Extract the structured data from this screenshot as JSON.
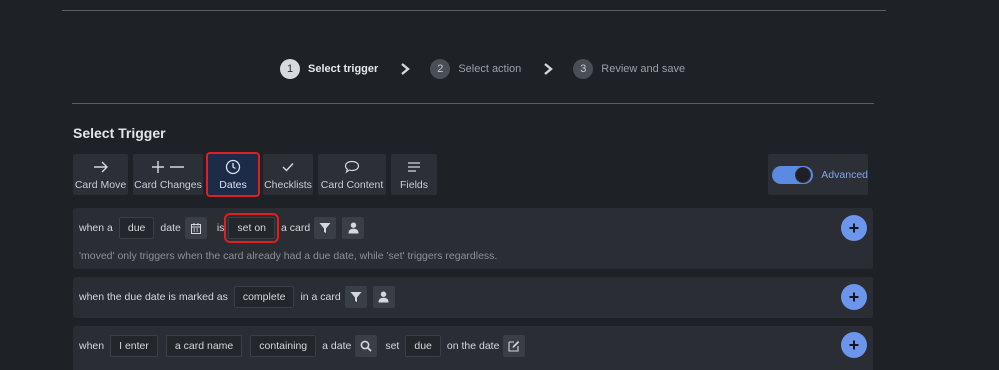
{
  "stepper": {
    "steps": [
      {
        "num": "1",
        "label": "Select trigger"
      },
      {
        "num": "2",
        "label": "Select action"
      },
      {
        "num": "3",
        "label": "Review and save"
      }
    ]
  },
  "section_title": "Select Trigger",
  "tabs": [
    {
      "label": "Card Move",
      "icon": "arrow-right-icon"
    },
    {
      "label": "Card Changes",
      "icon": "plus-minus-icon"
    },
    {
      "label": "Dates",
      "icon": "clock-icon"
    },
    {
      "label": "Checklists",
      "icon": "check-icon"
    },
    {
      "label": "Card Content",
      "icon": "speech-bubble-icon"
    },
    {
      "label": "Fields",
      "icon": "lines-icon"
    }
  ],
  "advanced": {
    "label": "Advanced",
    "on": true
  },
  "rule1": {
    "t1": "when a",
    "chip_due": "due",
    "t2": "date",
    "t3": "is",
    "chip_set": "set on",
    "t4": "a card",
    "hint": "'moved' only triggers when the card already had a due date, while 'set' triggers regardless."
  },
  "rule2": {
    "t1": "when the due date is marked as",
    "chip": "complete",
    "t2": "in a card"
  },
  "rule3": {
    "t1": "when",
    "chip_enter": "I enter",
    "chip_name": "a card name",
    "chip_contain": "containing",
    "t2": "a date",
    "t3": "set",
    "chip_due": "due",
    "t4": "on the date"
  },
  "colors": {
    "accent": "#6b96ec",
    "selected_tab": "#1c2b48",
    "highlight": "#e02020"
  }
}
